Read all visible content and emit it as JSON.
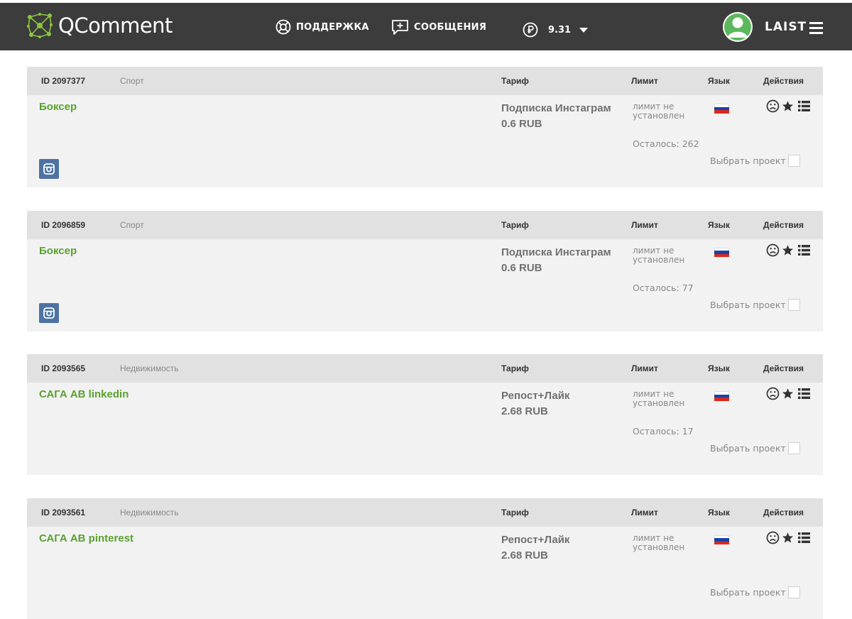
{
  "header": {
    "logo_text": "QComment",
    "nav": {
      "support": "ПОДДЕРЖКА",
      "messages": "СООБЩЕНИЯ"
    },
    "balance": "9.31",
    "username": "LAIST"
  },
  "colors": {
    "header_bg": "#3c3c3c",
    "brand_green": "#8cc63e",
    "project_name": "#5aa12f",
    "card_bg": "#f2f2f2",
    "card_head_bg": "#e1e1e1",
    "instagram_badge": "#4e73a1"
  },
  "columns": {
    "tariff": "Тариф",
    "limit": "Лимит",
    "language": "Язык",
    "actions": "Действия"
  },
  "icons": {
    "logo": "network-logo-icon",
    "support": "lifebuoy-icon",
    "messages": "message-plus-icon",
    "currency": "ruble-icon",
    "balance_dropdown": "caret-down-icon",
    "menu": "hamburger-menu-icon",
    "actions": [
      "sad-face-icon",
      "star-icon",
      "list-icon"
    ],
    "language": "russia-flag-icon",
    "network": "instagram-icon"
  },
  "select_label": "Выбрать проект",
  "limit_text": [
    "лимит не",
    "установлен"
  ],
  "projects": [
    {
      "id": "ID 2097377",
      "category": "Спорт",
      "name": "Боксер",
      "tariff_name": "Подписка Инстаграм",
      "price": "0.6 RUB",
      "remaining": "Осталось: 262",
      "has_network_badge": true
    },
    {
      "id": "ID 2096859",
      "category": "Спорт",
      "name": "Боксер",
      "tariff_name": "Подписка Инстаграм",
      "price": "0.6 RUB",
      "remaining": "Осталось: 77",
      "has_network_badge": true
    },
    {
      "id": "ID 2093565",
      "category": "Недвижимость",
      "name": "САГА АВ linkedin",
      "tariff_name": "Репост+Лайк",
      "price": "2.68 RUB",
      "remaining": "Осталось: 17",
      "has_network_badge": false
    },
    {
      "id": "ID 2093561",
      "category": "Недвижимость",
      "name": "САГА АВ pinterest",
      "tariff_name": "Репост+Лайк",
      "price": "2.68 RUB",
      "remaining": "",
      "has_network_badge": false
    }
  ]
}
